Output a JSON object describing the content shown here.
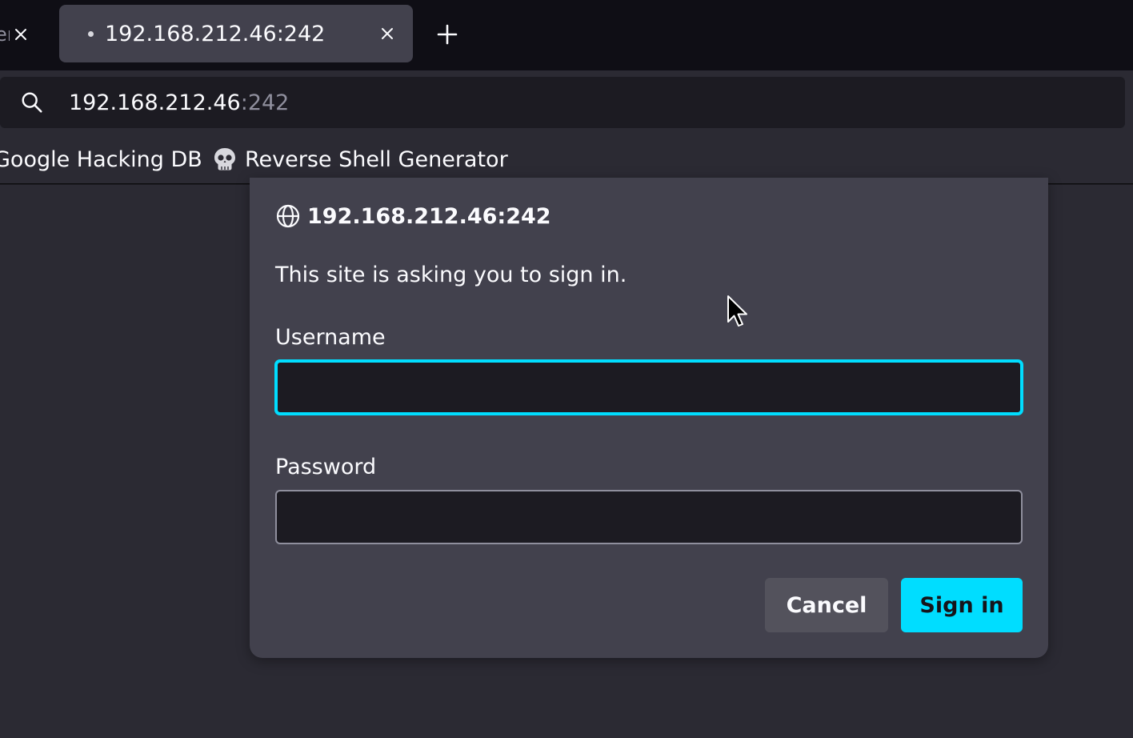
{
  "tabs": {
    "partial_tab": {
      "fragment": "er"
    },
    "active_tab": {
      "title": "192.168.212.46:242"
    }
  },
  "urlbar": {
    "host": "192.168.212.46",
    "port": ":242"
  },
  "bookmarks": [
    {
      "label": "Google Hacking DB"
    },
    {
      "label": "Reverse Shell Generator",
      "icon": "skull-icon"
    }
  ],
  "auth_dialog": {
    "origin": "192.168.212.46:242",
    "message": "This site is asking you to sign in.",
    "username_label": "Username",
    "username_value": "",
    "password_label": "Password",
    "password_value": "",
    "cancel_label": "Cancel",
    "signin_label": "Sign in"
  },
  "colors": {
    "accent": "#00ddff",
    "dialog_bg": "#42414d",
    "toolbar_bg": "#2b2a33",
    "tabstrip_bg": "#0f0e15"
  }
}
